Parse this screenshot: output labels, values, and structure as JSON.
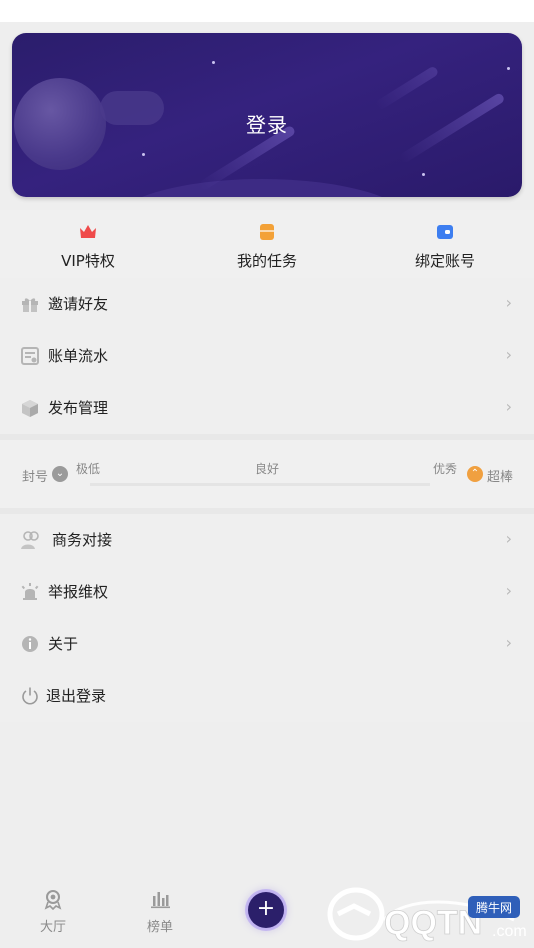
{
  "banner": {
    "login_label": "登录"
  },
  "quick_actions": [
    {
      "label": "VIP特权",
      "icon": "crown-icon",
      "color": "#ef4a4a"
    },
    {
      "label": "我的任务",
      "icon": "task-box-icon",
      "color": "#f3a137"
    },
    {
      "label": "绑定账号",
      "icon": "wallet-icon",
      "color": "#3d7ef0"
    }
  ],
  "menu_primary": [
    {
      "label": "邀请好友",
      "icon": "gift-icon"
    },
    {
      "label": "账单流水",
      "icon": "bill-icon"
    },
    {
      "label": "发布管理",
      "icon": "cube-icon"
    }
  ],
  "rating": {
    "left_label": "封号",
    "levels": [
      "极低",
      "良好",
      "优秀"
    ],
    "right_label": "超棒"
  },
  "menu_secondary": [
    {
      "label": "商务对接",
      "icon": "business-contact-icon"
    },
    {
      "label": "举报维权",
      "icon": "alarm-icon"
    },
    {
      "label": "关于",
      "icon": "info-icon"
    }
  ],
  "logout": {
    "label": "退出登录",
    "icon": "power-icon"
  },
  "bottom_nav": [
    {
      "label": "大厅",
      "icon": "hall-icon"
    },
    {
      "label": "榜单",
      "icon": "chart-bars-icon"
    },
    {
      "label": "+",
      "icon": "plus-icon"
    }
  ],
  "watermark": {
    "brand": "QQTN",
    "domain_suffix": ".com",
    "site_name": "腾牛网"
  },
  "colors": {
    "banner_dark": "#2b1d6c",
    "banner_mid": "#35227e",
    "background": "#eeeeee",
    "rating_bad": "#9a9a9a",
    "rating_good": "#f0a040"
  }
}
